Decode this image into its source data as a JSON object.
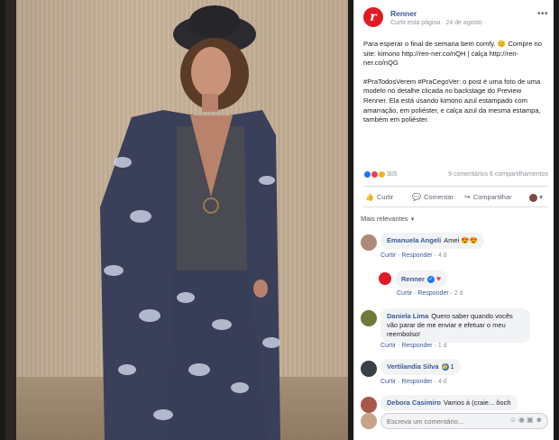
{
  "post": {
    "page_name": "Renner",
    "avatar_letter": "r",
    "meta": "Curtir esta página · 24 de agosto ·",
    "text_p1": "Para esperar o final de semana bem comfy. 😊 Compre no site: kimono http://ren-ner.co/nQH | calça http://ren-ner.co/nQG",
    "text_p2": "#PraTodosVerem #PraCegoVer: o post é uma foto de uma modelo no detalhe clicada no backstage do Preview Renner. Ela está usando kimono azul estampado com amarração, em poliéster, e calça azul da mesma estampa, também em poliéster.",
    "reaction_count": "305",
    "comments_shares": "9 comentários 6 compartilhamentos"
  },
  "actions": {
    "like": "Curtir",
    "comment": "Comentar",
    "share": "Compartilhar"
  },
  "relevance": "Mais relevantes",
  "comments": [
    {
      "name": "Emanuela Angeli",
      "text": "Amei 😍😍",
      "actions": "Curtir · Responder ·",
      "time": "4 d",
      "avatar_color": "#b08a78"
    },
    {
      "name": "Renner",
      "text": "♥",
      "actions": "Curtir · Responder ·",
      "time": "2 d",
      "avatar_color": "#e11b22"
    },
    {
      "name": "Daniela Lima",
      "text": "Quero saber quando vocês vão parar de me enviar e efetuar o meu reembolso!",
      "actions": "Curtir · Responder ·",
      "time": "1 d",
      "avatar_color": "#6e7a3a"
    },
    {
      "name": "Vertilandia Silva",
      "text": "",
      "reaction": "1",
      "actions": "Curtir · Responder ·",
      "time": "4 d",
      "avatar_color": "#3a3f46"
    },
    {
      "name": "Debora Casimiro",
      "text": "Vamos à (craie... ôoch",
      "actions": "",
      "time": "",
      "avatar_color": "#a8584a"
    }
  ],
  "write_placeholder": "Escreva um comentário...",
  "icons": [
    "more-icon",
    "like-icon",
    "comment-icon",
    "share-icon",
    "verified-icon",
    "emoji-icon",
    "camera-icon",
    "gif-icon",
    "sticker-icon"
  ],
  "colors": {
    "brand": "#e11b22",
    "link": "#385898",
    "like": "#1877f2"
  }
}
